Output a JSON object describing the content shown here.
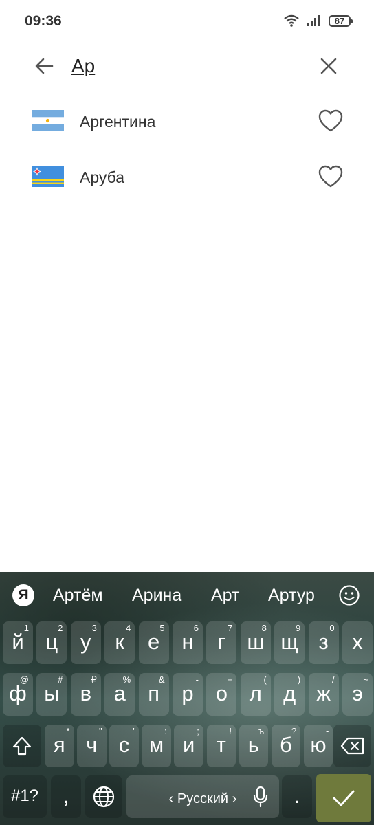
{
  "status_bar": {
    "time": "09:36",
    "battery": "87"
  },
  "search": {
    "query": "Ар"
  },
  "results": [
    {
      "name": "Аргентина",
      "flag": "argentina-flag-icon"
    },
    {
      "name": "Аруба",
      "flag": "aruba-flag-icon"
    }
  ],
  "keyboard": {
    "logo": "Я",
    "suggestions": [
      "Артём",
      "Арина",
      "Арт",
      "Артур"
    ],
    "row1": [
      {
        "k": "й",
        "h": "1"
      },
      {
        "k": "ц",
        "h": "2"
      },
      {
        "k": "у",
        "h": "3"
      },
      {
        "k": "к",
        "h": "4"
      },
      {
        "k": "е",
        "h": "5"
      },
      {
        "k": "н",
        "h": "6"
      },
      {
        "k": "г",
        "h": "7"
      },
      {
        "k": "ш",
        "h": "8"
      },
      {
        "k": "щ",
        "h": "9"
      },
      {
        "k": "з",
        "h": "0"
      },
      {
        "k": "х",
        "h": ""
      }
    ],
    "row2": [
      {
        "k": "ф",
        "h": "@"
      },
      {
        "k": "ы",
        "h": "#"
      },
      {
        "k": "в",
        "h": "₽"
      },
      {
        "k": "а",
        "h": "%"
      },
      {
        "k": "п",
        "h": "&"
      },
      {
        "k": "р",
        "h": "-"
      },
      {
        "k": "о",
        "h": "+"
      },
      {
        "k": "л",
        "h": "("
      },
      {
        "k": "д",
        "h": ")"
      },
      {
        "k": "ж",
        "h": "/"
      },
      {
        "k": "э",
        "h": "~"
      }
    ],
    "row3": [
      {
        "k": "я",
        "h": "*"
      },
      {
        "k": "ч",
        "h": "\""
      },
      {
        "k": "с",
        "h": "'"
      },
      {
        "k": "м",
        "h": ":"
      },
      {
        "k": "и",
        "h": ";"
      },
      {
        "k": "т",
        "h": "!"
      },
      {
        "k": "ь",
        "h": "ъ"
      },
      {
        "k": "б",
        "h": "?"
      },
      {
        "k": "ю",
        "h": "-"
      }
    ],
    "symbols_label": "#1?",
    "comma_label": ",",
    "space_label": "‹ Русский ›",
    "period_label": "."
  }
}
